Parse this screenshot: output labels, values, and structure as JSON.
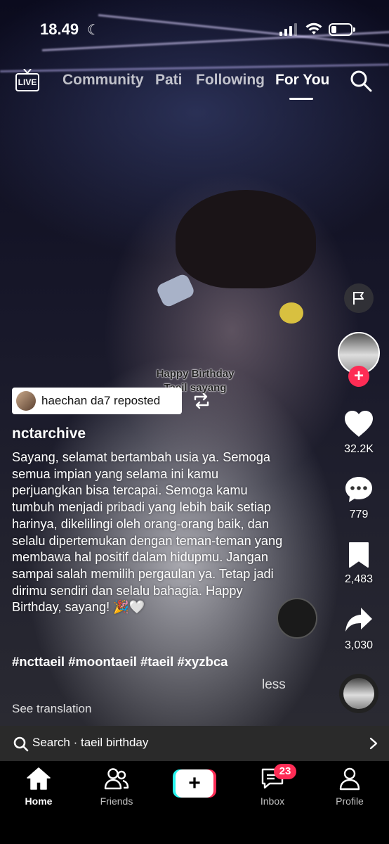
{
  "status_bar": {
    "time": "18.49"
  },
  "top_nav": {
    "live_label": "LIVE",
    "tabs": [
      {
        "label": "Community",
        "active": false
      },
      {
        "label": "Pati",
        "active": false
      },
      {
        "label": "Following",
        "active": false
      },
      {
        "label": "For You",
        "active": true
      }
    ]
  },
  "video": {
    "overlay_text": "Happy Birthday\nTaeil sayang"
  },
  "right_rail": {
    "likes": "32.2K",
    "comments": "779",
    "bookmarks": "2,483",
    "shares": "3,030"
  },
  "repost": {
    "label": "haechan da7 reposted"
  },
  "post": {
    "username": "nctarchive",
    "caption": "Sayang, selamat bertambah usia ya. Semoga semua impian yang selama ini kamu perjuangkan bisa tercapai. Semoga kamu tumbuh menjadi pribadi yang lebih baik setiap harinya, dikelilingi oleh orang-orang baik, dan selalu dipertemukan dengan teman-teman yang membawa hal positif dalam hidupmu. Jangan sampai salah memilih pergaulan ya. Tetap jadi dirimu sendiri dan selalu bahagia. Happy Birthday, sayang! 🎉🤍",
    "hashtags": "#ncttaeil #moontaeil #taeil #xyzbca",
    "less_label": "less",
    "translate_label": "See translation"
  },
  "search_bar": {
    "text": "Search · taeil birthday"
  },
  "bottom_nav": {
    "home": "Home",
    "friends": "Friends",
    "inbox": "Inbox",
    "inbox_badge": "23",
    "profile": "Profile"
  },
  "colors": {
    "accent": "#fe2c55",
    "accent2": "#25f4ee"
  }
}
